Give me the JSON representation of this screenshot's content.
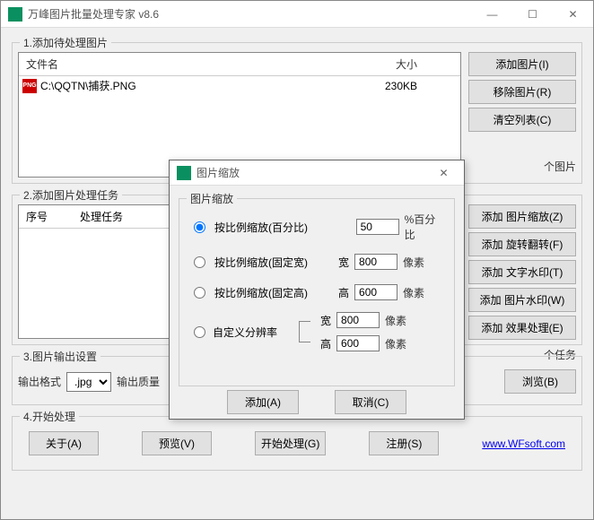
{
  "app": {
    "title": "万峰图片批量处理专家 v8.6"
  },
  "section1": {
    "title": "1.添加待处理图片",
    "col_name": "文件名",
    "col_size": "大小",
    "files": [
      {
        "path": "C:\\QQTN\\捕获.PNG",
        "size": "230KB",
        "icon_text": "PNG"
      }
    ],
    "btn_add": "添加图片(I)",
    "btn_remove": "移除图片(R)",
    "btn_clear": "清空列表(C)",
    "count_suffix": "个图片"
  },
  "section2": {
    "title": "2.添加图片处理任务",
    "col_idx": "序号",
    "col_task": "处理任务",
    "btn_zoom": "添加 图片缩放(Z)",
    "btn_rotate": "添加 旋转翻转(F)",
    "btn_textwm": "添加 文字水印(T)",
    "btn_imgwm": "添加 图片水印(W)",
    "btn_effect": "添加 效果处理(E)",
    "count_suffix": "个任务"
  },
  "section3": {
    "title": "3.图片输出设置",
    "format_label": "输出格式",
    "format_value": ".jpg",
    "quality_label": "输出质量",
    "btn_browse": "浏览(B)"
  },
  "section4": {
    "title": "4.开始处理",
    "btn_about": "关于(A)",
    "btn_preview": "预览(V)",
    "btn_start": "开始处理(G)",
    "btn_register": "注册(S)",
    "link": "www.WFsoft.com"
  },
  "modal": {
    "title": "图片缩放",
    "group_title": "图片缩放",
    "r1_label": "按比例缩放(百分比)",
    "r1_value": "50",
    "r1_unit": "%百分比",
    "r2_label": "按比例缩放(固定宽)",
    "r2_wlabel": "宽",
    "r2_value": "800",
    "r2_unit": "像素",
    "r3_label": "按比例缩放(固定高)",
    "r3_hlabel": "高",
    "r3_value": "600",
    "r3_unit": "像素",
    "r4_label": "自定义分辨率",
    "r4_wlabel": "宽",
    "r4_wvalue": "800",
    "r4_wunit": "像素",
    "r4_hlabel": "高",
    "r4_hvalue": "600",
    "r4_hunit": "像素",
    "btn_add": "添加(A)",
    "btn_cancel": "取消(C)"
  }
}
